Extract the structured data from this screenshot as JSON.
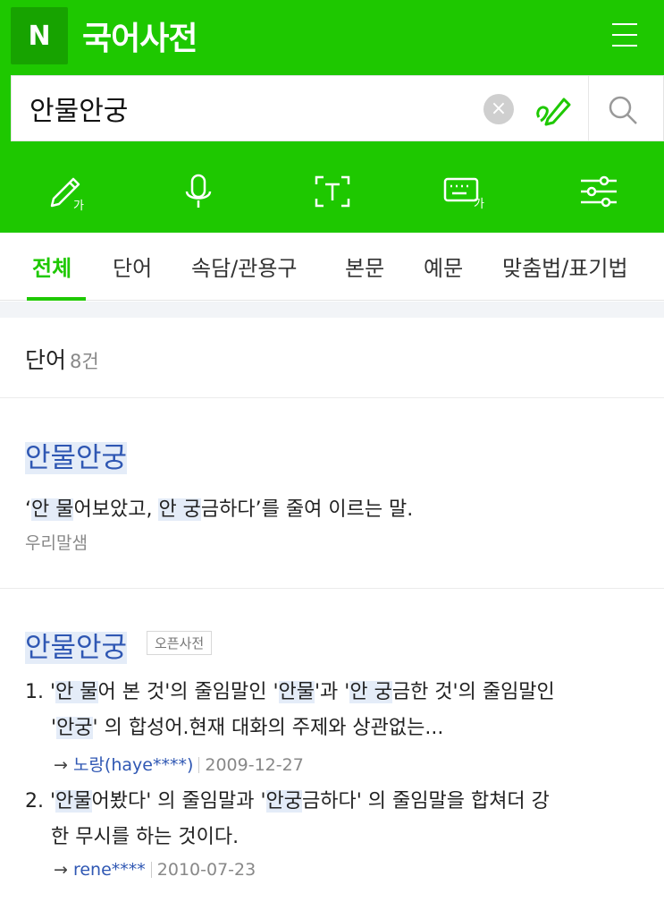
{
  "header": {
    "logo_letter": "N",
    "title": "국어사전"
  },
  "search": {
    "query": "안물안궁"
  },
  "tabs": [
    "전체",
    "단어",
    "속담/관용구",
    "본문",
    "예문",
    "맞춤법/표기법"
  ],
  "section": {
    "label": "단어",
    "count": "8건"
  },
  "entry1": {
    "title": "안물안궁",
    "def_part1": "‘",
    "def_hl1": "안 물",
    "def_part2": "어보았고, ",
    "def_hl2": "안 궁",
    "def_part3": "금하다’를 줄여 이르는 말.",
    "source": "우리말샘"
  },
  "entry2": {
    "title": "안물안궁",
    "badge": "오픈사전",
    "item1_line1_a": "1. '",
    "item1_line1_hl1": "안 물",
    "item1_line1_b": "어 본 것'의 줄임말인 '",
    "item1_line1_hl2": "안물",
    "item1_line1_c": "'과 '",
    "item1_line1_hl3": "안 궁",
    "item1_line1_d": "금한 것'의 줄임말인",
    "item1_line2_a": "'",
    "item1_line2_hl": "안궁",
    "item1_line2_b": "' 의 합성어.현재 대화의 주제와 상관없는...",
    "item1_author": "노랑(haye****)",
    "item1_date": "2009-12-27",
    "item2_line1_a": "2. '",
    "item2_line1_hl1": "안물",
    "item2_line1_b": "어봤다' 의 줄임말과 '",
    "item2_line1_hl2": "안궁",
    "item2_line1_c": "금하다' 의 줄임말을 합쳐더 강",
    "item2_line2": "한 무시를 하는 것이다.",
    "item2_author": "rene****",
    "item2_date": "2010-07-23",
    "arrow": "→"
  },
  "colors": {
    "brand_green": "#1ec800",
    "link_blue": "#2f57b3"
  },
  "icons": [
    "handwriting-icon",
    "mic-icon",
    "text-scan-icon",
    "keyboard-icon",
    "settings-sliders-icon",
    "search-icon",
    "clear-icon",
    "menu-icon"
  ]
}
